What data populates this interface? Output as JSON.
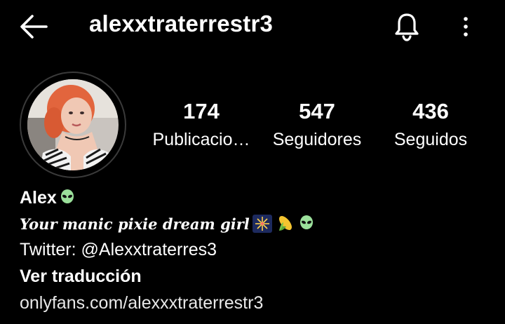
{
  "header": {
    "username": "alexxtraterrestr3",
    "back_icon": "arrow-left-icon",
    "bell_icon": "bell-icon",
    "more_icon": "more-vertical-icon"
  },
  "profile": {
    "avatar_icon": "profile-photo",
    "stats": [
      {
        "value": "174",
        "label": "Publicacio…"
      },
      {
        "value": "547",
        "label": "Seguidores"
      },
      {
        "value": "436",
        "label": "Seguidos"
      }
    ]
  },
  "bio": {
    "name": "Alex",
    "tagline": "Your manic pixie dream girl",
    "twitter": "Twitter: @Alexxtraterres3",
    "translate": "Ver traducción",
    "link": "onlyfans.com/alexxxtraterrestr3",
    "emojis": [
      "alien-emoji",
      "fireworks-emoji",
      "corn-emoji",
      "alien-emoji"
    ]
  },
  "colors": {
    "background": "#000000",
    "text": "#ffffff",
    "alien": "#9be09b"
  }
}
